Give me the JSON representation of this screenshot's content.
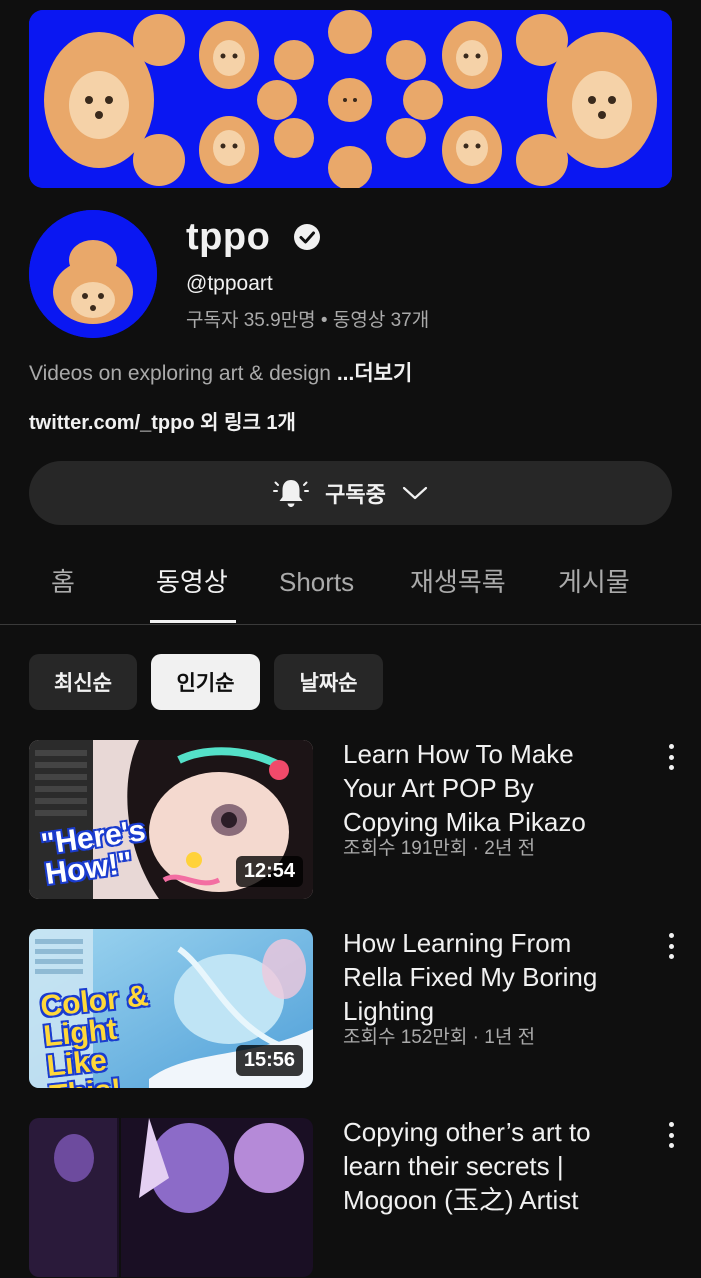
{
  "channel": {
    "name": "tppo",
    "handle": "@tppoart",
    "stats": "구독자 35.9만명 • 동영상 37개",
    "description": "Videos on exploring art & design",
    "more_label": "...더보기",
    "links": "twitter.com/_tppo 외 링크 1개"
  },
  "subscribe": {
    "label": "구독중"
  },
  "tabs": [
    {
      "label": "홈"
    },
    {
      "label": "동영상"
    },
    {
      "label": "Shorts"
    },
    {
      "label": "재생목록"
    },
    {
      "label": "게시물"
    }
  ],
  "active_tab": "동영상",
  "filters": [
    {
      "label": "최신순",
      "selected": false
    },
    {
      "label": "인기순",
      "selected": true
    },
    {
      "label": "날짜순",
      "selected": false
    }
  ],
  "videos": [
    {
      "title": "Learn How To Make Your Art POP By Copying Mika Pikazo",
      "meta": "조회수 191만회 · 2년 전",
      "duration": "12:54",
      "thumb_text": "\"Here's How!\""
    },
    {
      "title": "How Learning From Rella Fixed My Boring Lighting",
      "meta": "조회수 152만회 · 1년 전",
      "duration": "15:56",
      "thumb_text": "Color & Light Like This!"
    },
    {
      "title": "Copying other’s art to learn their secrets | Mogoon (玉之) Artist",
      "meta": "",
      "duration": "",
      "thumb_text": ""
    }
  ],
  "colors": {
    "background": "#0f0f0f",
    "banner_blue": "#0a17f2",
    "bear": "#e9a86a",
    "surface": "#272727",
    "text_secondary": "#aaaaaa"
  }
}
